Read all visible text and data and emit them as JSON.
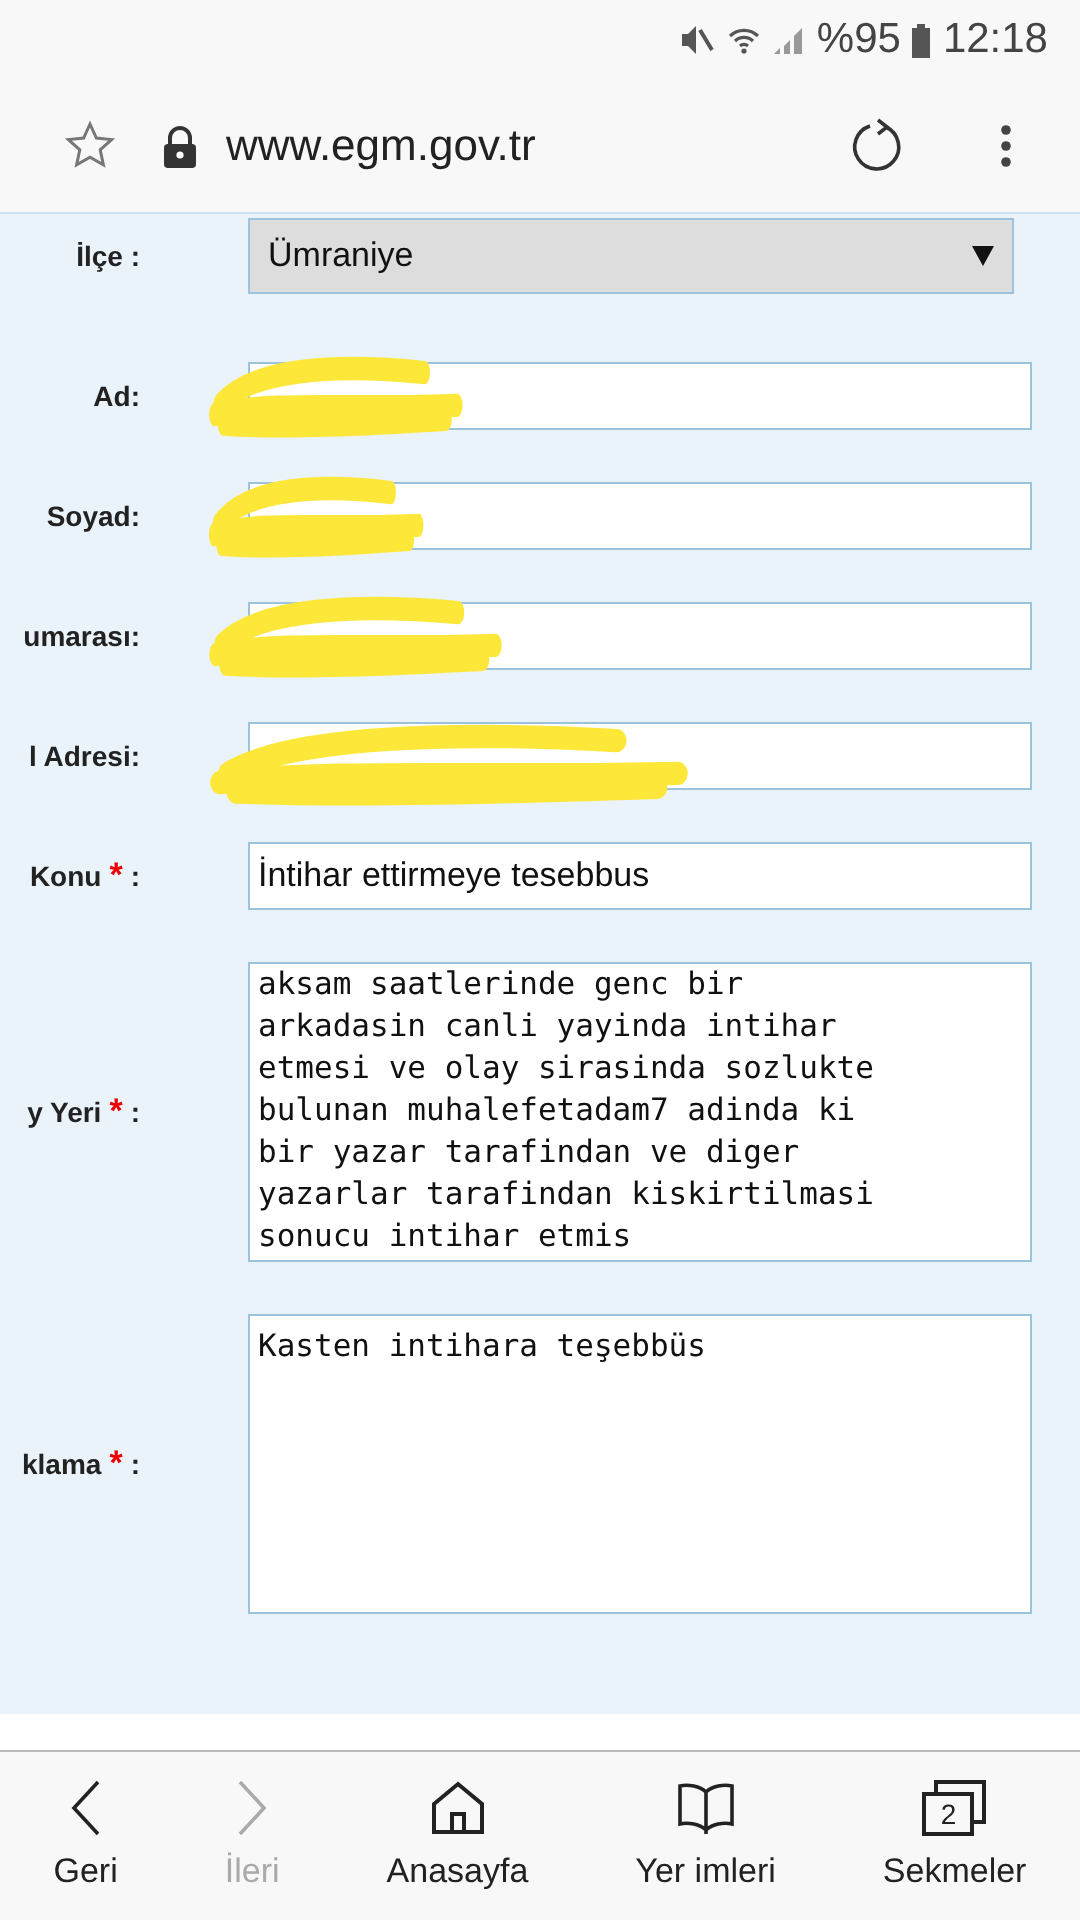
{
  "status_bar": {
    "battery": "%95",
    "time": "12:18"
  },
  "address_bar": {
    "url": "www.egm.gov.tr"
  },
  "form": {
    "fields": [
      {
        "kind": "select",
        "label": "İlçe :",
        "value": "Ümraniye",
        "redacted": false
      },
      {
        "kind": "input",
        "label": "Ad:",
        "redacted": true
      },
      {
        "kind": "input",
        "label": "Soyad:",
        "redacted": true
      },
      {
        "kind": "input",
        "label": "umarası:",
        "redacted": true
      },
      {
        "kind": "input",
        "label": "l Adresi:",
        "redacted": true
      },
      {
        "kind": "input",
        "label": "Konu",
        "asterisk": "*",
        "suffix": ":",
        "value": "İntihar ettirmeye tesebbus",
        "redacted": false
      },
      {
        "kind": "textarea",
        "label": "y Yeri",
        "asterisk": "*",
        "suffix": ":",
        "value": "aksam saatlerinde genc bir\narkadasin canli yayinda intihar\netmesi ve olay sirasinda sozlukte\nbulunan muhalefetadam7 adinda ki\nbir yazar tarafindan ve diger\nyazarlar tarafindan kiskirtilmasi\nsonucu intihar etmis",
        "redacted": false
      },
      {
        "kind": "textarea",
        "label": "klama",
        "asterisk": "*",
        "suffix": ":",
        "value": "Kasten intihara teşebbüs",
        "redacted": false
      }
    ]
  },
  "bottom_nav": [
    {
      "kind": "back",
      "label": "Geri",
      "disabled": false
    },
    {
      "kind": "forward",
      "label": "İleri",
      "disabled": true
    },
    {
      "kind": "home",
      "label": "Anasayfa",
      "disabled": false
    },
    {
      "kind": "bookmarks",
      "label": "Yer imleri",
      "disabled": false
    },
    {
      "kind": "tabs",
      "label": "Sekmeler",
      "badge": "2",
      "disabled": false
    }
  ]
}
